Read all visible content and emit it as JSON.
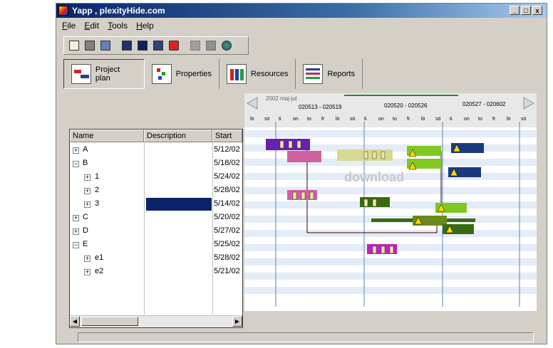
{
  "window": {
    "title": "Yapp , plexityHide.com",
    "controls": [
      "_",
      "□",
      "x"
    ]
  },
  "menu": [
    "File",
    "Edit",
    "Tools",
    "Help"
  ],
  "toolbar": {
    "icons": [
      "new-doc-icon",
      "open-folder-icon",
      "save-icon",
      "cut-icon",
      "copy-icon",
      "paste-icon",
      "redo-icon",
      "disabled-icon",
      "tool-icon",
      "globe-icon"
    ]
  },
  "tabs": [
    {
      "label": "Project plan",
      "icon": "project-plan-icon"
    },
    {
      "label": "Properties",
      "icon": "properties-icon"
    },
    {
      "label": "Resources",
      "icon": "resources-icon"
    },
    {
      "label": "Reports",
      "icon": "reports-icon"
    }
  ],
  "grid": {
    "columns": [
      "Name",
      "Description",
      "Start"
    ],
    "rows": [
      {
        "name": "A",
        "start": "5/12/02",
        "sign": "+"
      },
      {
        "name": "B",
        "start": "5/18/02",
        "sign": "−"
      },
      {
        "name": "1",
        "start": "5/24/02",
        "sign": "+"
      },
      {
        "name": "2",
        "start": "5/28/02",
        "sign": "+"
      },
      {
        "name": "3",
        "start": "5/14/02",
        "sign": "+"
      },
      {
        "name": "C",
        "start": "5/20/02",
        "sign": "+"
      },
      {
        "name": "D",
        "start": "5/27/02",
        "sign": "+"
      },
      {
        "name": "E",
        "start": "5/25/02",
        "sign": "−"
      },
      {
        "name": "e1",
        "start": "5/28/02",
        "sign": "+"
      },
      {
        "name": "e2",
        "start": "5/21/02",
        "sign": "+"
      }
    ]
  },
  "timeline": {
    "period": "2002 maj-jul",
    "weeks": [
      "020513 - 020519",
      "020520 - 020526",
      "020527 - 020602"
    ],
    "days": [
      "lö",
      "sö",
      "ti",
      "on",
      "to",
      "fr",
      "lö",
      "sö",
      "ti",
      "on",
      "to",
      "fr",
      "lö",
      "sö",
      "ti",
      "on",
      "to",
      "fr",
      "lö",
      "sö"
    ]
  },
  "watermark": "download",
  "colors": {
    "title_start": "#0a246a",
    "title_end": "#a6caf0",
    "selection": "#0a246a",
    "row_stripe": "#e4ecf8"
  }
}
